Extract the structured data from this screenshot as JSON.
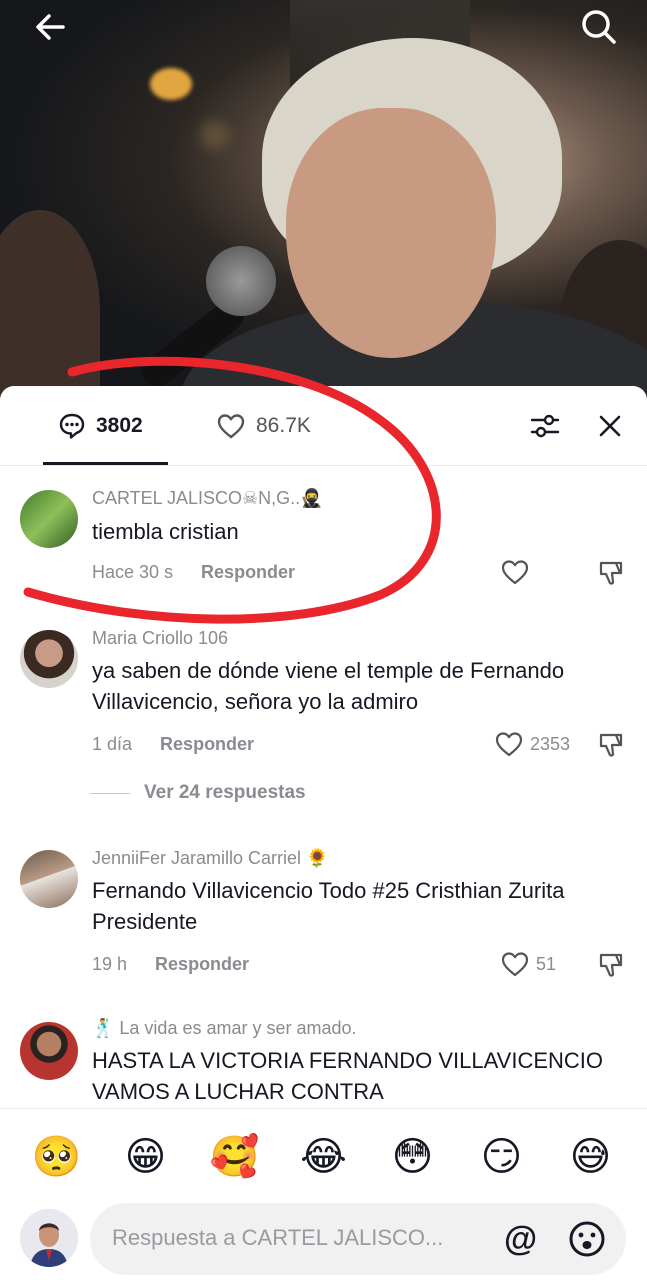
{
  "video": {},
  "nav": {
    "back_icon": "arrow-left-icon",
    "search_icon": "search-icon"
  },
  "tabs": {
    "comments_count": "3802",
    "likes_count": "86.7K"
  },
  "comments": [
    {
      "username": "CARTEL JALISCO☠N,G..🥷",
      "text": "tiembla cristian",
      "time": "Hace 30 s",
      "reply_label": "Responder",
      "likes": ""
    },
    {
      "username": "Maria Criollo 106",
      "text": "ya saben de dónde viene el temple de Fernando Villavicencio, señora yo la admiro",
      "time": "1 día",
      "reply_label": "Responder",
      "likes": "2353",
      "replies_label": "Ver 24 respuestas"
    },
    {
      "username": "JenniiFer Jaramillo Carriel 🌻",
      "text": "Fernando Villavicencio Todo #25 Cristhian Zurita Presidente",
      "time": "19 h",
      "reply_label": "Responder",
      "likes": "51"
    },
    {
      "username": "🕺 La vida es amar y ser amado.",
      "text": "HASTA LA VICTORIA FERNANDO VILLAVICENCIO VAMOS A LUCHAR CONTRA"
    }
  ],
  "quick_emojis": [
    "🥺",
    "😁",
    "🥰",
    "😂",
    "😳",
    "😏",
    "😅"
  ],
  "input": {
    "placeholder": "Respuesta a CARTEL JALISCO...",
    "at_symbol": "@"
  },
  "colors": {
    "annotation": "#e8262b",
    "text_primary": "#161823",
    "text_secondary": "#8a8b91"
  }
}
